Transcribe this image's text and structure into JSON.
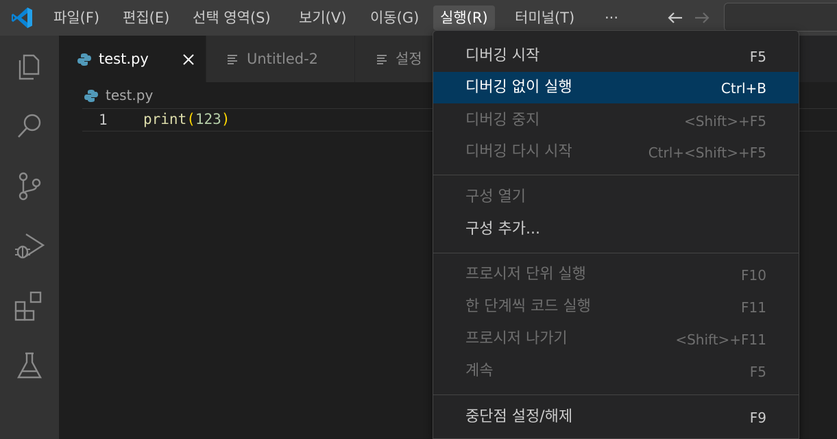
{
  "menubar": {
    "items": [
      "파일(F)",
      "편집(E)",
      "선택 영역(S)",
      "보기(V)",
      "이동(G)",
      "실행(R)",
      "터미널(T)",
      "···"
    ]
  },
  "tabs": [
    {
      "label": "test.py",
      "icon": "python-icon",
      "active": true
    },
    {
      "label": "Untitled-2",
      "icon": "file-lines-icon",
      "active": false
    },
    {
      "label": "설정",
      "icon": "file-lines-icon",
      "active": false
    }
  ],
  "breadcrumb": {
    "file": "test.py"
  },
  "editor": {
    "line_number": "1",
    "code": {
      "fn": "print",
      "open": "(",
      "num": "123",
      "close": ")"
    }
  },
  "run_menu": {
    "items": [
      {
        "label": "디버깅 시작",
        "shortcut": "F5",
        "state": "normal"
      },
      {
        "label": "디버깅 없이 실행",
        "shortcut": "Ctrl+B",
        "state": "highlight"
      },
      {
        "label": "디버깅 중지",
        "shortcut": "<Shift>+F5",
        "state": "disabled"
      },
      {
        "label": "디버깅 다시 시작",
        "shortcut": "Ctrl+<Shift>+F5",
        "state": "disabled"
      },
      {
        "label": "구성 열기",
        "shortcut": "",
        "state": "disabled"
      },
      {
        "label": "구성 추가...",
        "shortcut": "",
        "state": "normal"
      },
      {
        "label": "프로시저 단위 실행",
        "shortcut": "F10",
        "state": "disabled"
      },
      {
        "label": "한 단계씩 코드 실행",
        "shortcut": "F11",
        "state": "disabled"
      },
      {
        "label": "프로시저 나가기",
        "shortcut": "<Shift>+F11",
        "state": "disabled"
      },
      {
        "label": "계속",
        "shortcut": "F5",
        "state": "disabled"
      },
      {
        "label": "중단점 설정/해제",
        "shortcut": "F9",
        "state": "normal"
      }
    ]
  },
  "colors": {
    "accent": "#007acc",
    "highlight": "#04395e",
    "python_blue": "#519aba"
  }
}
